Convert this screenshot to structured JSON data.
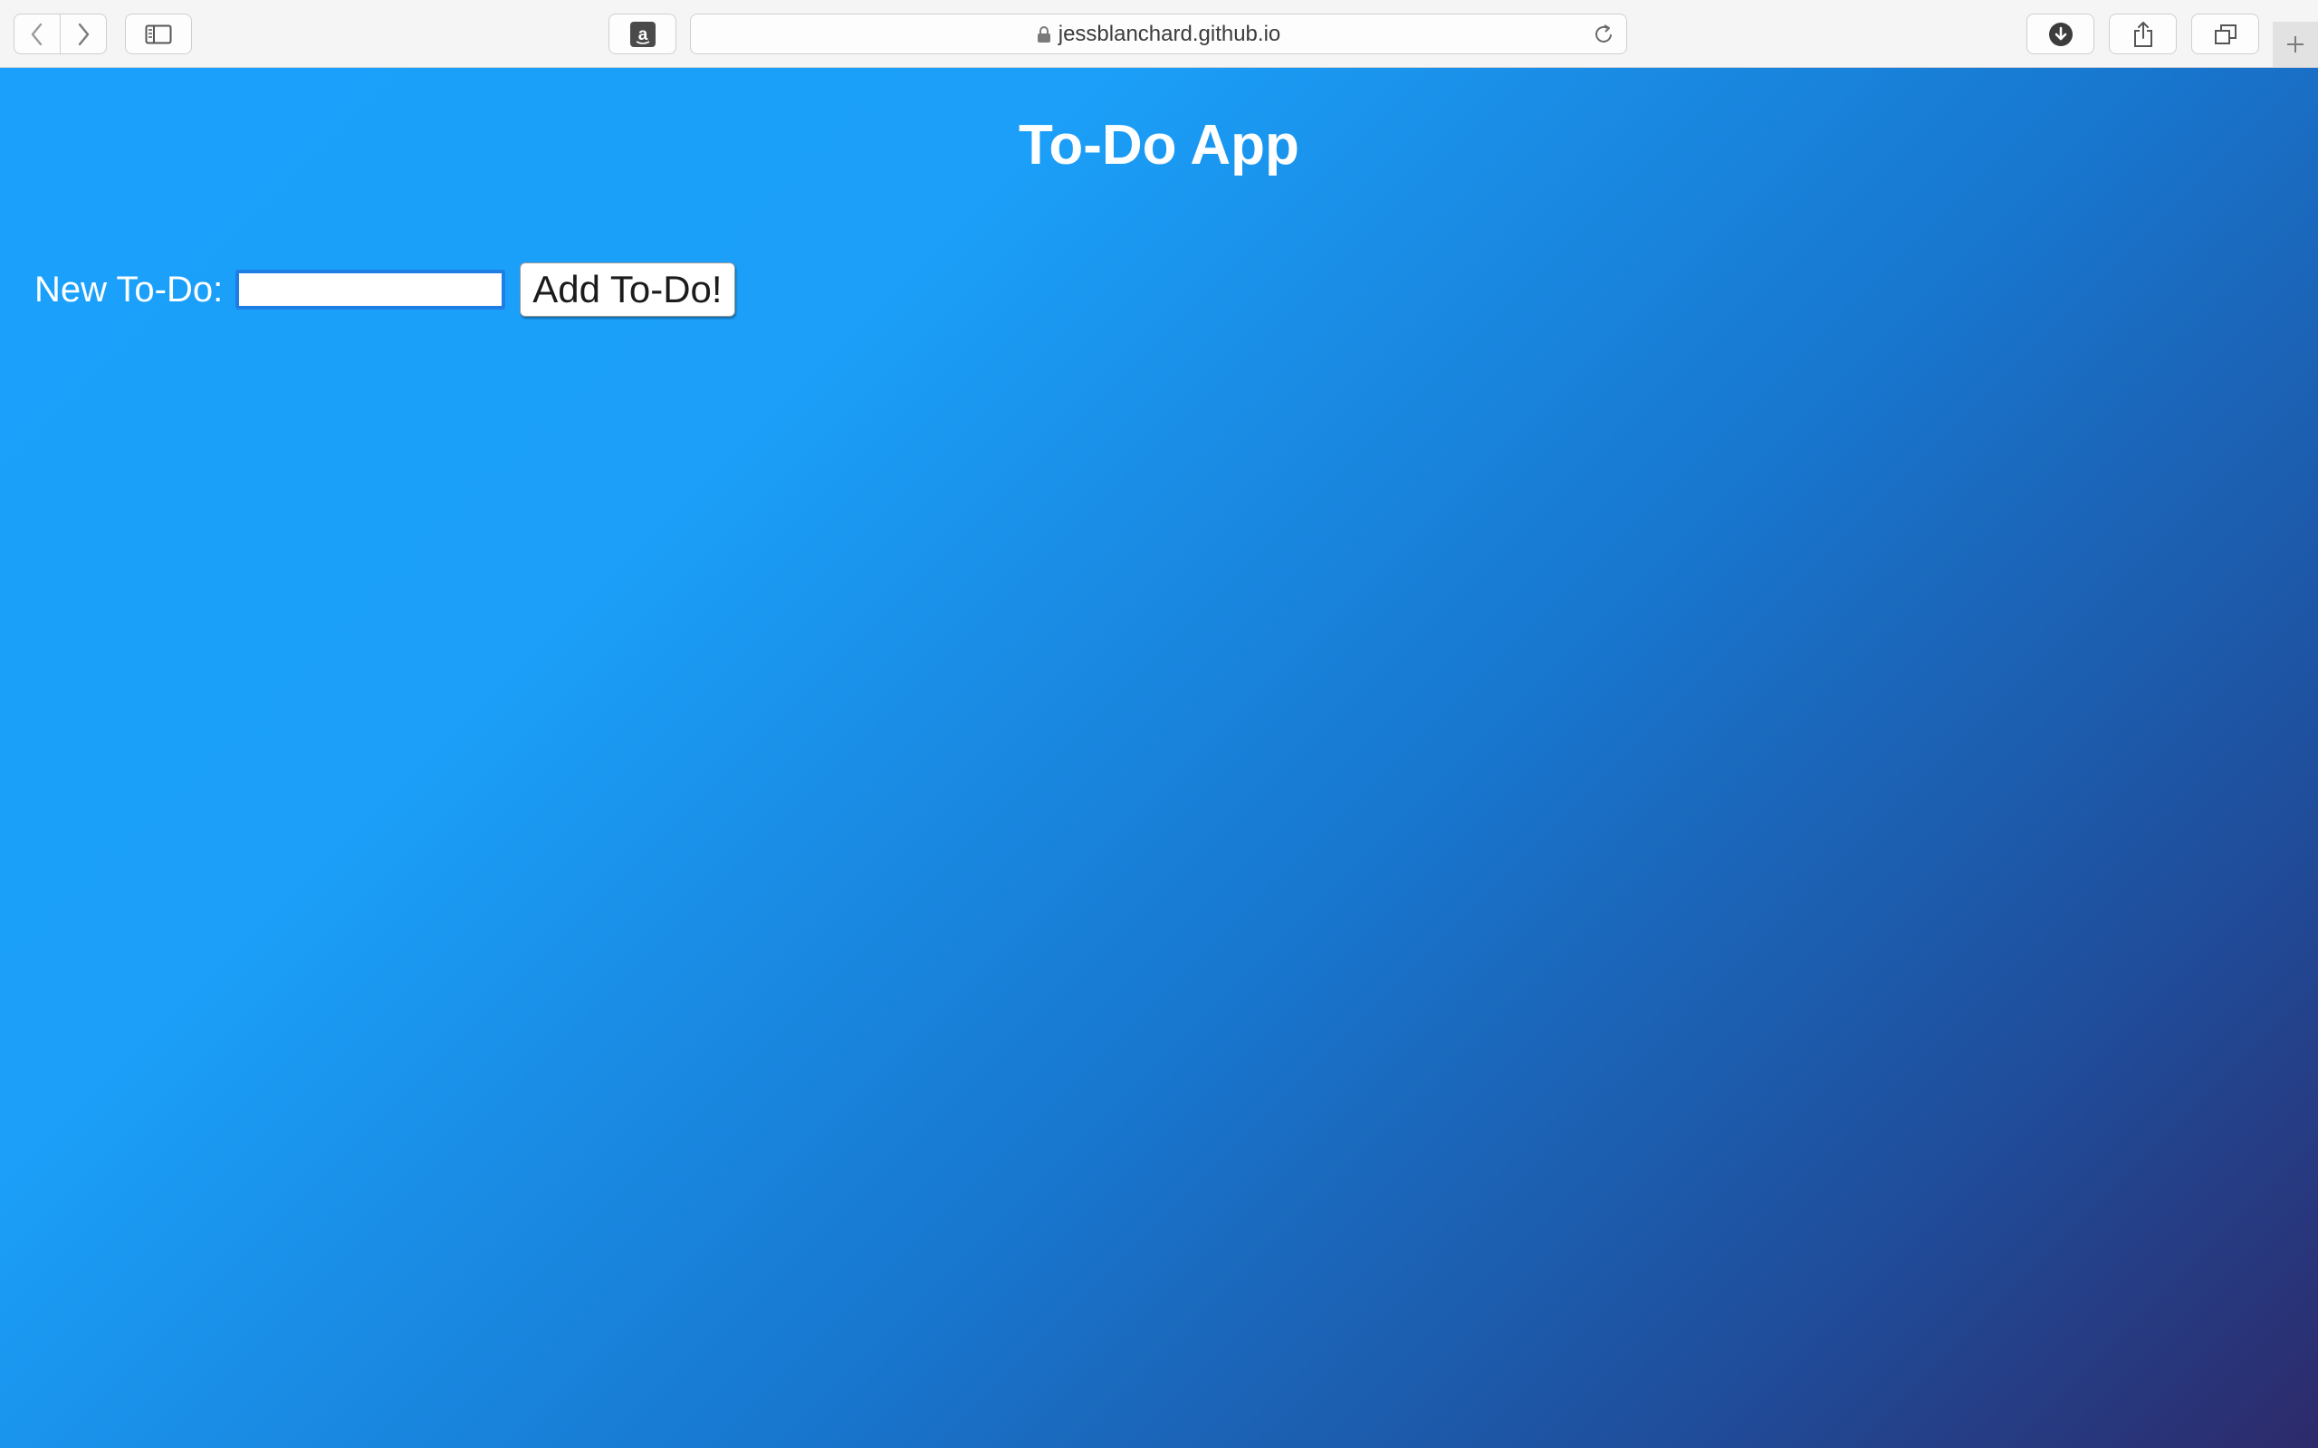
{
  "browser": {
    "url": "jessblanchard.github.io",
    "icons": {
      "back": "chevron-left-icon",
      "forward": "chevron-right-icon",
      "sidebar": "sidebar-icon",
      "amazon": "amazon-icon",
      "lock": "lock-icon",
      "reload": "reload-icon",
      "download": "download-icon",
      "share": "share-icon",
      "tabs": "tabs-overview-icon",
      "new_tab": "plus-icon"
    }
  },
  "app": {
    "title": "To-Do App",
    "form": {
      "label": "New To-Do:",
      "input_value": "",
      "button_label": "Add To-Do!"
    }
  },
  "colors": {
    "gradient_start": "#1ba1fc",
    "gradient_end": "#2d2a6b",
    "input_focus_border": "#1f7de6"
  }
}
